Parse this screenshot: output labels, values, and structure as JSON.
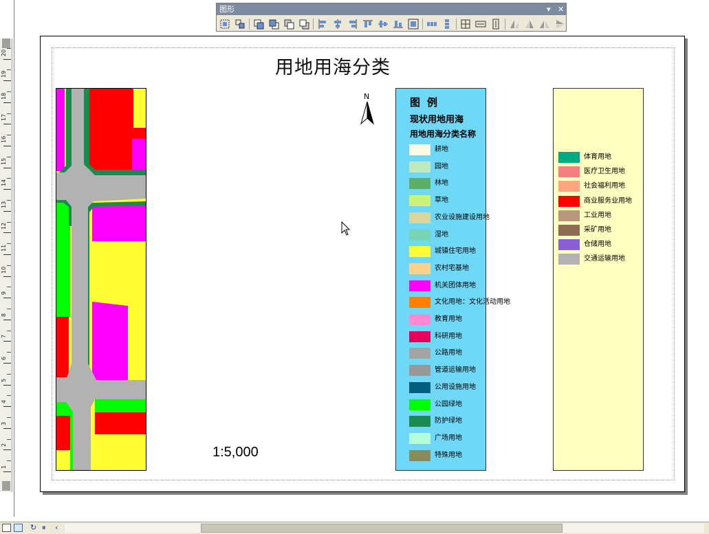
{
  "toolbar": {
    "title": "图形",
    "close": "✕",
    "menu_arrow": "▾",
    "buttons": [
      "group-icon",
      "ungroup-icon",
      "bring-to-front-icon",
      "send-to-back-icon",
      "bring-forward-icon",
      "send-backward-icon",
      "align-left-icon",
      "align-center-icon",
      "align-right-icon",
      "align-top-icon",
      "align-middle-icon",
      "align-bottom-icon",
      "align-to-margins-icon",
      "distribute-horizontally-icon",
      "distribute-vertically-icon",
      "make-same-size-icon",
      "fit-width-icon",
      "fit-height-icon",
      "rotate-left-icon",
      "rotate-right-icon",
      "flip-horizontal-icon",
      "flip-vertical-icon"
    ]
  },
  "ruler": {
    "labels": [
      "1",
      "2",
      "3",
      "4",
      "5",
      "6",
      "7",
      "8",
      "9",
      "10",
      "11",
      "12",
      "13",
      "14",
      "15",
      "16",
      "17",
      "18",
      "19",
      "20"
    ]
  },
  "layout": {
    "title": "用地用海分类",
    "north": "N",
    "scale": "1:5,000"
  },
  "legend1": {
    "title": "图例",
    "subtitle1": "现状用地用海",
    "subtitle2": "用地用海分类名称",
    "items": [
      {
        "label": "耕地",
        "color": "#fdfbe6"
      },
      {
        "label": "园地",
        "color": "#bfeabf"
      },
      {
        "label": "林地",
        "color": "#5daf65"
      },
      {
        "label": "草地",
        "color": "#ccf27a"
      },
      {
        "label": "农业设施建设用地",
        "color": "#dad59d"
      },
      {
        "label": "湿地",
        "color": "#77d4b5"
      },
      {
        "label": "城镇住宅用地",
        "color": "#ffff33"
      },
      {
        "label": "农村宅基地",
        "color": "#ffd28a"
      },
      {
        "label": "机关团体用地",
        "color": "#ff00ff"
      },
      {
        "label": "文化用地：文化活动用地",
        "color": "#ff7f00"
      },
      {
        "label": "教育用地",
        "color": "#ff8ad0"
      },
      {
        "label": "科研用地",
        "color": "#e6005c"
      },
      {
        "label": "公路用地",
        "color": "#a3a3a3"
      },
      {
        "label": "管道运输用地",
        "color": "#999999"
      },
      {
        "label": "公用设施用地",
        "color": "#005f7f"
      },
      {
        "label": "公园绿地",
        "color": "#00ff00"
      },
      {
        "label": "防护绿地",
        "color": "#1a8a4f"
      },
      {
        "label": "广场用地",
        "color": "#b3ffd9"
      },
      {
        "label": "特殊用地",
        "color": "#8a8a5a"
      }
    ]
  },
  "legend2": {
    "items": [
      {
        "label": "体育用地",
        "color": "#00a884"
      },
      {
        "label": "医疗卫生用地",
        "color": "#f57f7f"
      },
      {
        "label": "社会福利用地",
        "color": "#ffa57f"
      },
      {
        "label": "商业服务业用地",
        "color": "#ff0000"
      },
      {
        "label": "工业用地",
        "color": "#b8977a"
      },
      {
        "label": "采矿用地",
        "color": "#8f6a52"
      },
      {
        "label": "仓储用地",
        "color": "#8a5fd6"
      },
      {
        "label": "交通运输用地",
        "color": "#b2b2b2"
      }
    ]
  }
}
